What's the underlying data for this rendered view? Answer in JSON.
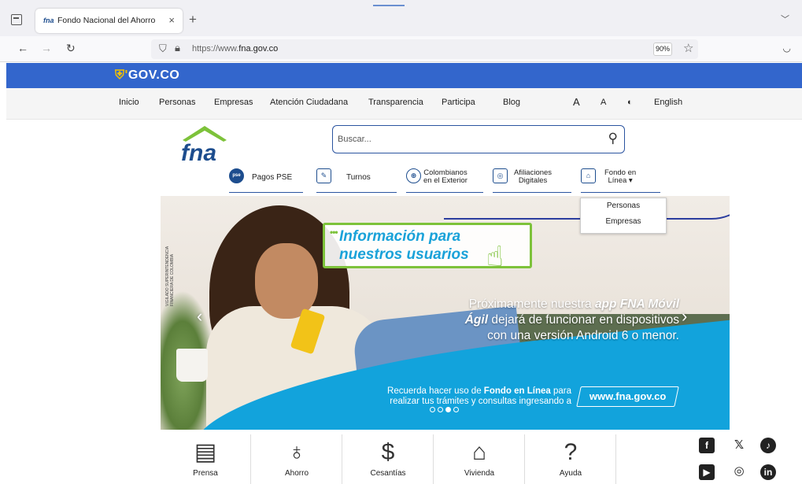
{
  "browser": {
    "tab_title": "Fondo Nacional del Ahorro",
    "tab_favicon": "fna",
    "tab_close": "×",
    "new_tab": "+",
    "url_prefix": "https://www.",
    "url_domain": "fna.gov.co",
    "zoom": "90%"
  },
  "gov_bar": {
    "logo_text": "GOV.CO"
  },
  "top_nav": {
    "items": [
      "Inicio",
      "Personas",
      "Empresas",
      "Atención Ciudadana",
      "Transparencia",
      "Participa",
      "Blog"
    ],
    "font_large": "A",
    "font_small": "A",
    "contrast": "◐",
    "language": "English"
  },
  "header": {
    "logo_text": "fna",
    "search_placeholder": "Buscar..."
  },
  "services": [
    {
      "label": "Pagos PSE",
      "icon": "pse-icon"
    },
    {
      "label": "Turnos",
      "icon": "turnos-icon"
    },
    {
      "label_line1": "Colombianos",
      "label_line2": "en el Exterior",
      "icon": "globe-icon"
    },
    {
      "label_line1": "Afiliaciones",
      "label_line2": "Digitales",
      "icon": "fingerprint-icon"
    },
    {
      "label_line1": "Fondo en",
      "label_line2": "Línea ▾",
      "icon": "lock-icon"
    }
  ],
  "dropdown": {
    "items": [
      "Personas",
      "Empresas"
    ]
  },
  "banner": {
    "bubble_line1": "Información para",
    "bubble_line2": "nuestros usuarios",
    "promo_pre": "Próximamente nuestra ",
    "promo_bold": "app FNA Móvil Ágil",
    "promo_post": " dejará de funcionar en dispositivos con una versión Android 6 o menor.",
    "remind_pre": "Recuerda hacer uso de ",
    "remind_bold": "Fondo en Línea",
    "remind_post": " para realizar tus trámites y consultas ingresando a",
    "url_badge": "www.fna.gov.co",
    "vigilado": "VIGILADO SUPERINTENDENCIA FINANCIERA DE COLOMBIA",
    "prev": "‹",
    "next": "›"
  },
  "bottom_nav": [
    {
      "label": "Prensa",
      "icon": "newspaper-icon"
    },
    {
      "label": "Ahorro",
      "icon": "piggy-bank-icon"
    },
    {
      "label": "Cesantías",
      "icon": "coins-icon"
    },
    {
      "label": "Vivienda",
      "icon": "house-icon"
    },
    {
      "label": "Ayuda",
      "icon": "help-icon"
    }
  ],
  "social": [
    "f",
    "𝕏",
    "♪",
    "▶",
    "◎",
    "in"
  ],
  "colors": {
    "gov_blue": "#3366cc",
    "fna_green": "#7dc23a",
    "banner_cyan": "#12a3dc",
    "fna_navy": "#1d4d8e"
  }
}
